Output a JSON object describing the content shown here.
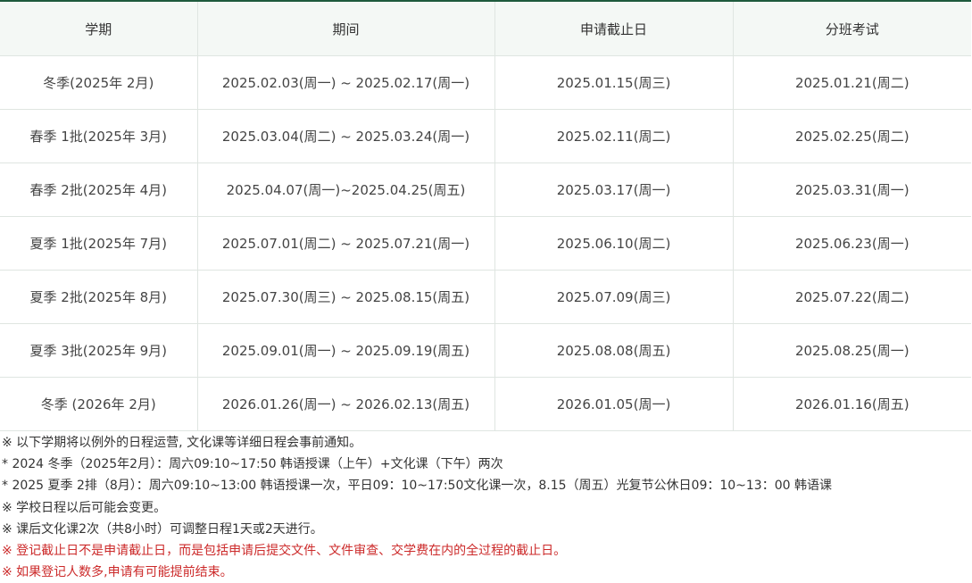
{
  "table": {
    "headers": [
      "学期",
      "期间",
      "申请截止日",
      "分班考试"
    ],
    "rows": [
      [
        "冬季(2025年 2月)",
        "2025.02.03(周一) ~ 2025.02.17(周一)",
        "2025.01.15(周三)",
        "2025.01.21(周二)"
      ],
      [
        "春季 1批(2025年 3月)",
        "2025.03.04(周二) ~ 2025.03.24(周一)",
        "2025.02.11(周二)",
        "2025.02.25(周二)"
      ],
      [
        "春季 2批(2025年 4月)",
        "2025.04.07(周一)~2025.04.25(周五)",
        "2025.03.17(周一)",
        "2025.03.31(周一)"
      ],
      [
        "夏季 1批(2025年 7月)",
        "2025.07.01(周二) ~ 2025.07.21(周一)",
        "2025.06.10(周二)",
        "2025.06.23(周一)"
      ],
      [
        "夏季 2批(2025年 8月)",
        "2025.07.30(周三) ~ 2025.08.15(周五)",
        "2025.07.09(周三)",
        "2025.07.22(周二)"
      ],
      [
        "夏季 3批(2025年 9月)",
        "2025.09.01(周一) ~ 2025.09.19(周五)",
        "2025.08.08(周五)",
        "2025.08.25(周一)"
      ],
      [
        "冬季 (2026年 2月)",
        "2026.01.26(周一) ~  2026.02.13(周五)",
        "2026.01.05(周一)",
        "2026.01.16(周五)"
      ]
    ]
  },
  "notes": [
    "※ 以下学期将以例外的日程运营, 文化课等详细日程会事前通知。",
    "* 2024 冬季（2025年2月）：周六09:10~17:50 韩语授课（上午）+文化课（下午）两次",
    "* 2025 夏季 2排（8月）：周六09:10~13:00 韩语授课一次，平日09：10~17:50文化课一次，8.15（周五）光复节公休日09：10~13：00 韩语课",
    "※ 学校日程以后可能会变更。",
    "※ 课后文化课2次（共8小时）可调整日程1天或2天进行。",
    "※ 登记截止日不是申请截止日，而是包括申请后提交文件、文件审查、交学费在内的全过程的截止日。",
    "※ 如果登记人数多,申请有可能提前结束。"
  ],
  "colors": {
    "header_top_border": "#1e5a3c",
    "header_background": "#f4f8f5",
    "warning_text": "#cc2a2a"
  }
}
